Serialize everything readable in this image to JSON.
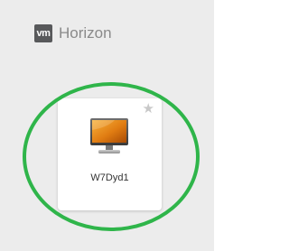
{
  "header": {
    "logo_text": "vm",
    "app_title": "Horizon"
  },
  "desktops": [
    {
      "name": "W7Dyd1",
      "icon": "monitor-icon",
      "favorite_icon": "star-icon",
      "favorite": false
    }
  ],
  "colors": {
    "sidebar_bg": "#ececec",
    "highlight_ring": "#2fb54a",
    "logo_bg": "#58595b",
    "title_text": "#8a8a8a"
  }
}
